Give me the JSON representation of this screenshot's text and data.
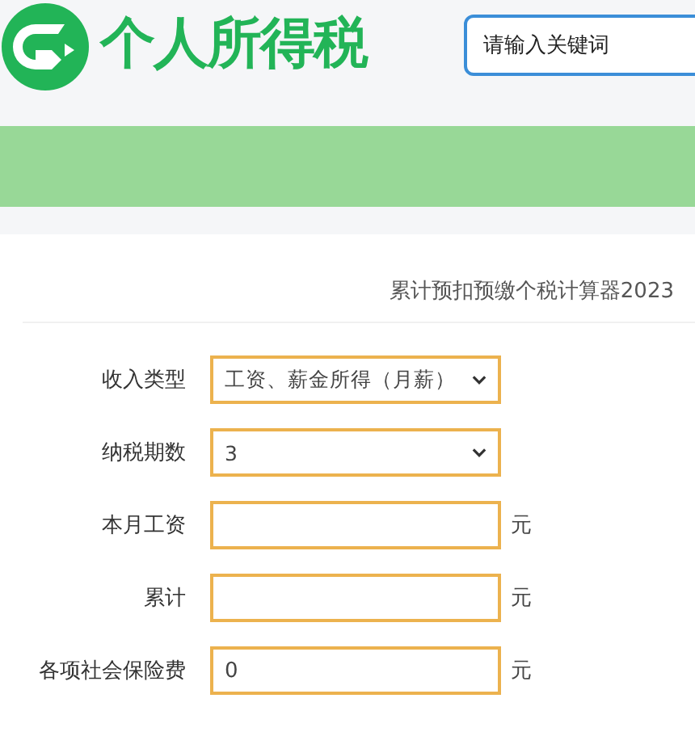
{
  "header": {
    "logo_text": "个人所得税",
    "search": {
      "placeholder": "请输入关键词"
    }
  },
  "calculator": {
    "title": "累计预扣预缴个税计算器2023",
    "fields": [
      {
        "kind": "select",
        "label": "收入类型",
        "value": "工资、薪金所得（月薪）"
      },
      {
        "kind": "select",
        "label": "纳税期数",
        "value": "3"
      },
      {
        "kind": "input",
        "label": "本月工资",
        "unit": "元"
      },
      {
        "kind": "input",
        "label": "累计",
        "unit": "元"
      },
      {
        "kind": "input",
        "label": "各项社会保险费",
        "value": "0",
        "unit": "元"
      }
    ]
  }
}
